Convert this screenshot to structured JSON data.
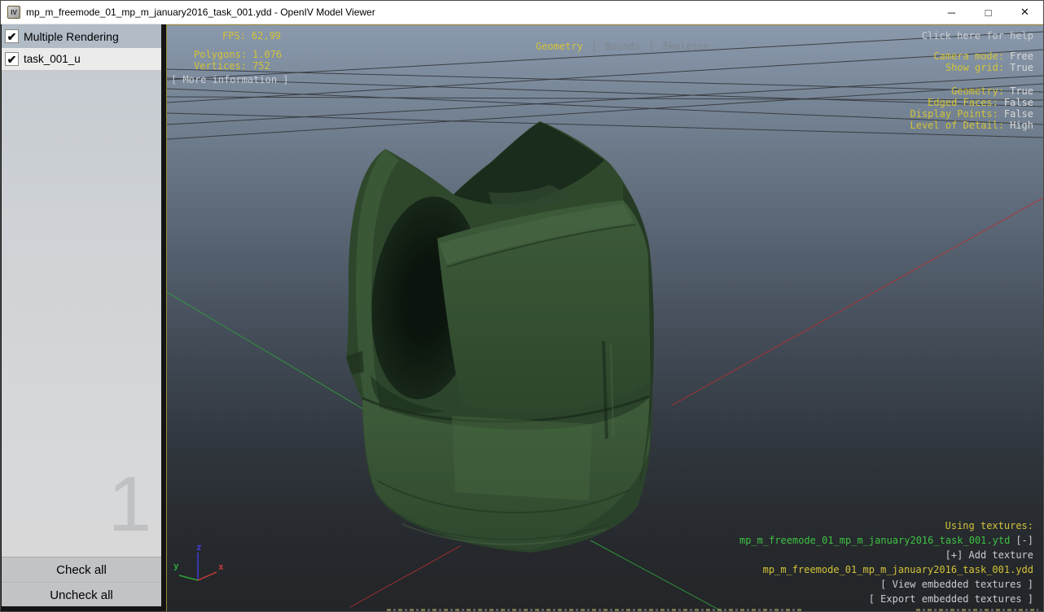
{
  "window": {
    "title": "mp_m_freemode_01_mp_m_january2016_task_001.ydd - OpenIV Model Viewer",
    "icon_label": "IV"
  },
  "icons": {
    "check": "✔",
    "minimize": "─",
    "maximize": "□",
    "close": "✕"
  },
  "sidebar": {
    "items": [
      {
        "label": "Multiple Rendering",
        "checked": true
      },
      {
        "label": "task_001_u",
        "checked": true
      }
    ],
    "watermark": "1",
    "check_all_label": "Check all",
    "uncheck_all_label": "Uncheck all"
  },
  "viewport": {
    "stats": {
      "fps_label": "FPS:",
      "fps": "62,99",
      "polygons_label": "Polygons:",
      "polygons": "1.076",
      "vertices_label": "Vertices:",
      "vertices": "752",
      "more_info": "[ More information ]"
    },
    "tabs": {
      "items": [
        "Geometry",
        "Bounds",
        "Skeleton"
      ],
      "active": "Geometry",
      "separator": "|"
    },
    "help": "Click here for help",
    "camera": [
      {
        "label": "Camera mode:",
        "value": "Free"
      },
      {
        "label": "Show grid:",
        "value": "True"
      }
    ],
    "render_options": [
      {
        "label": "Geometry:",
        "value": "True"
      },
      {
        "label": "Edged Faces:",
        "value": "False"
      },
      {
        "label": "Display Points:",
        "value": "False"
      },
      {
        "label": "Level of Detail:",
        "value": "High"
      }
    ],
    "textures": {
      "header": "Using textures:",
      "texture_file": "mp_m_freemode_01_mp_m_january2016_task_001.ytd",
      "remove_button": "[-]",
      "add_button": "[+] Add texture",
      "model_file": "mp_m_freemode_01_mp_m_january2016_task_001.ydd",
      "view_embedded": "[ View embedded textures ]",
      "export_embedded": "[ Export embedded textures ]"
    },
    "axis_gizmo": {
      "x": "x",
      "y": "y",
      "z": "z"
    },
    "colors": {
      "accent_yellow": "#d2c33a",
      "value_gray": "#d9d9d9",
      "texture_green": "#3fc244",
      "axis_red": "#b23131",
      "axis_green": "#2f9e3a",
      "axis_blue": "#3f3fd9"
    }
  }
}
